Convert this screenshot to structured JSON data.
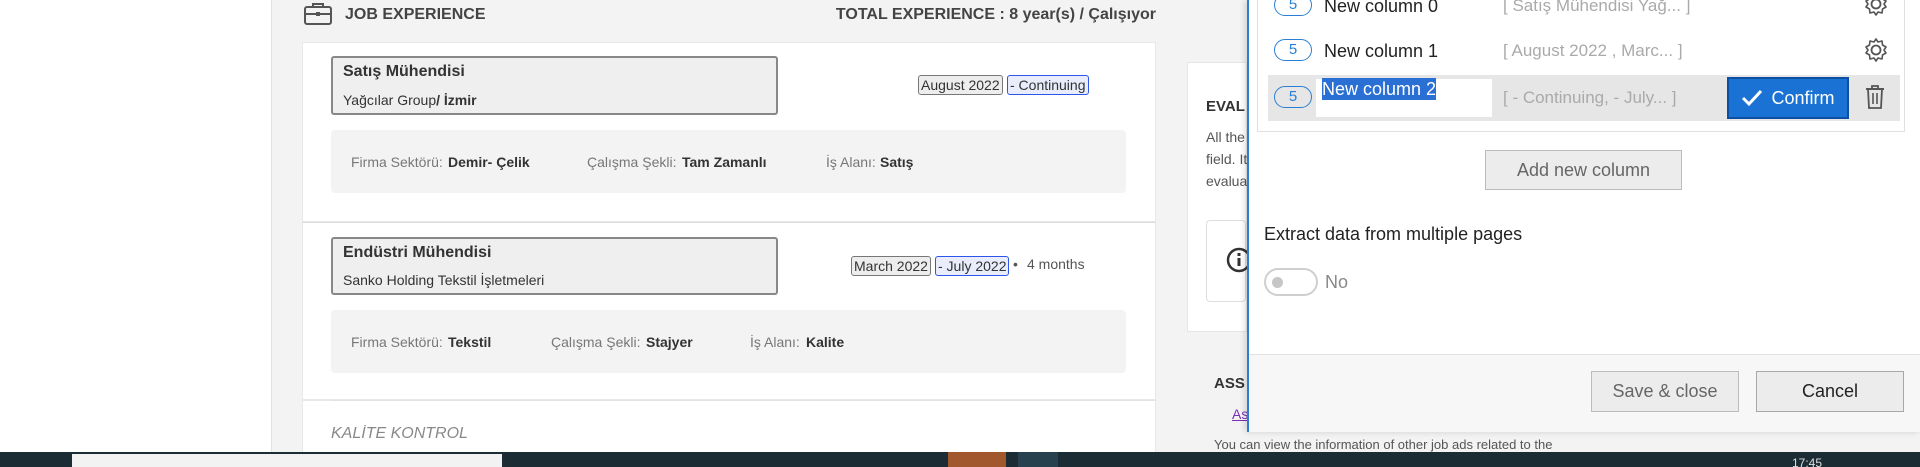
{
  "job_section": {
    "title": "JOB EXPERIENCE",
    "total_experience": "TOTAL EXPERIENCE : 8 year(s) / Çalışıyor",
    "entries": [
      {
        "position": "Satış Mühendisi",
        "company": "Yağcılar Group",
        "city": "/ İzmir",
        "start": "August 2022",
        "end": "- Continuing",
        "duration": "",
        "sector_label": "Firma Sektörü:",
        "sector": "Demir- Çelik",
        "work_type_label": "Çalışma Şekli:",
        "work_type": "Tam Zamanlı",
        "area_label": "İş Alanı:",
        "area": "Satış"
      },
      {
        "position": "Endüstri Mühendisi",
        "company": "Sanko Holding Tekstil İşletmeleri",
        "city": "",
        "start": "March 2022",
        "end": "- July 2022",
        "duration": "4 months",
        "sector_label": "Firma Sektörü:",
        "sector": "Tekstil",
        "work_type_label": "Çalışma Şekli:",
        "work_type": "Stajyer",
        "area_label": "İş Alanı:",
        "area": "Kalite"
      }
    ],
    "next_entry": "KALİTE KONTROL"
  },
  "side_panel": {
    "eval_title_fragment": "EVAL",
    "eval_text": [
      "All the",
      "field. It",
      "evalua"
    ],
    "ass_fragment": "ASS",
    "link_fragment": "As",
    "footer_text": "You can view the information of other job ads related to the"
  },
  "dialog": {
    "columns": [
      {
        "count": "5",
        "name": "New column 0",
        "preview": "[ Satış Mühendisi Yağ... ]"
      },
      {
        "count": "5",
        "name": "New column 1",
        "preview": "[ August 2022 , Marc... ]"
      },
      {
        "count": "5",
        "name": "New column 2",
        "preview": "[ - Continuing, - July... ]"
      }
    ],
    "confirm_label": "Confirm",
    "add_column_label": "Add new column",
    "multi_page_title": "Extract data from multiple pages",
    "multi_page_value": "No",
    "save_close_label": "Save & close",
    "cancel_label": "Cancel"
  },
  "taskbar": {
    "time": "17:45"
  },
  "colors": {
    "accent": "#1a73d4",
    "badge": "#2a7fd4",
    "date_highlight": "#2f54eb"
  }
}
